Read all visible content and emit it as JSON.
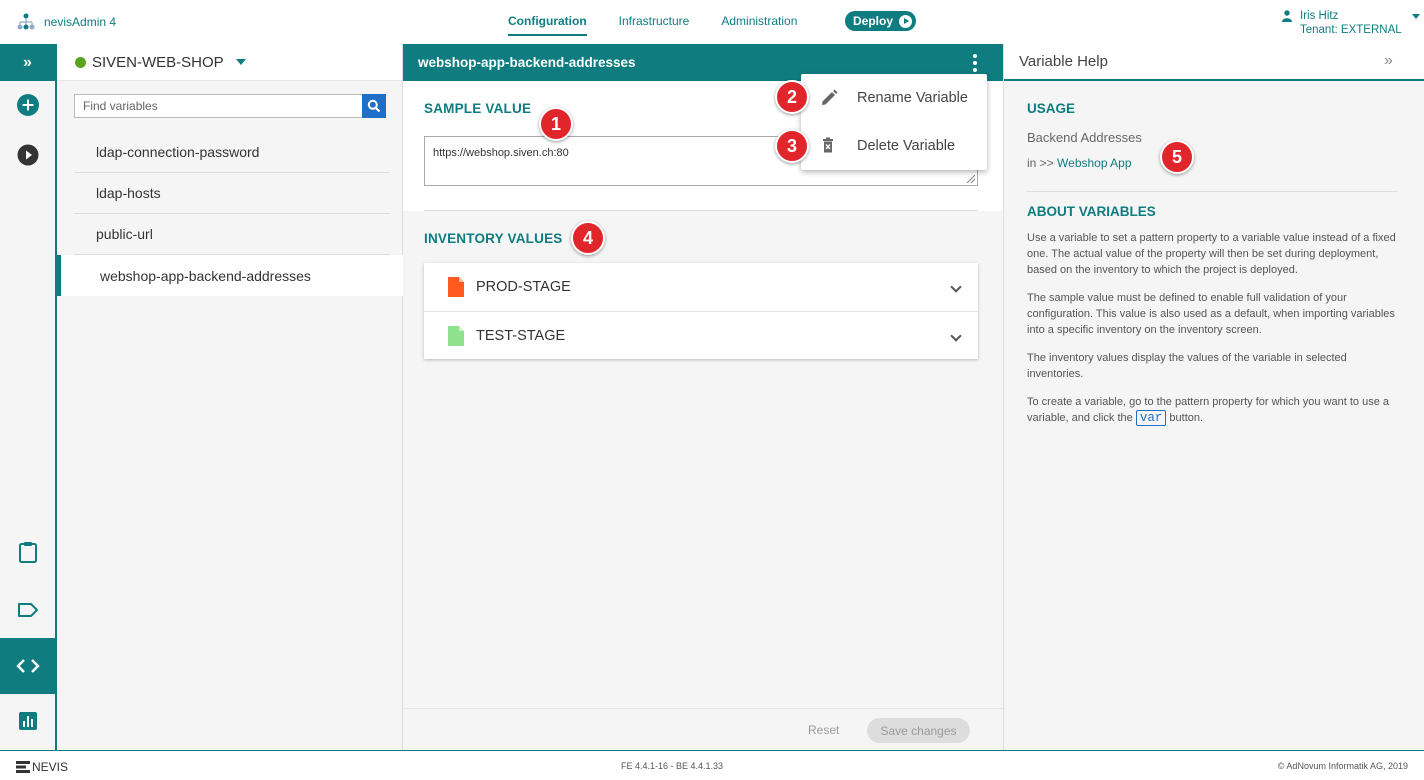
{
  "app": {
    "name": "nevisAdmin 4"
  },
  "nav": {
    "tabs": [
      {
        "label": "Configuration",
        "active": true
      },
      {
        "label": "Infrastructure",
        "active": false
      },
      {
        "label": "Administration",
        "active": false
      }
    ],
    "deploy_label": "Deploy"
  },
  "user": {
    "name": "Iris Hitz",
    "tenant": "Tenant: EXTERNAL"
  },
  "project": {
    "name": "SIVEN-WEB-SHOP",
    "status_color": "#5aa31e"
  },
  "search": {
    "placeholder": "Find variables"
  },
  "variables": [
    {
      "name": "ldap-connection-password"
    },
    {
      "name": "ldap-hosts"
    },
    {
      "name": "public-url"
    },
    {
      "name": "webshop-app-backend-addresses",
      "selected": true
    }
  ],
  "editor": {
    "title": "webshop-app-backend-addresses",
    "sample_value_title": "SAMPLE VALUE",
    "sample_value": "https://webshop.siven.ch:80",
    "inventory_title": "INVENTORY VALUES",
    "inventories": [
      {
        "name": "PROD-STAGE",
        "icon": "file-red-icon",
        "color": "#ff5a1f"
      },
      {
        "name": "TEST-STAGE",
        "icon": "file-green-icon",
        "color": "#8fe08f"
      }
    ],
    "reset_label": "Reset",
    "save_label": "Save changes"
  },
  "menu": {
    "items": [
      {
        "label": "Rename Variable",
        "icon": "pencil-icon"
      },
      {
        "label": "Delete Variable",
        "icon": "trash-icon"
      }
    ]
  },
  "help": {
    "title": "Variable Help",
    "usage_title": "USAGE",
    "usage_name": "Backend Addresses",
    "usage_in_prefix": "in >> ",
    "usage_link": "Webshop App",
    "about_title": "ABOUT VARIABLES",
    "paragraphs": [
      "Use a variable to set a pattern property to a variable value instead of a fixed one. The actual value of the property will then be set during deployment, based on the inventory to which the project is deployed.",
      "The sample value must be defined to enable full validation of your configuration. This value is also used as a default, when importing variables into a specific inventory on the inventory screen.",
      "The inventory values display the values of the variable in selected inventories."
    ],
    "last_para_before": "To create a variable, go to the pattern property for which you want to use a variable, and click the ",
    "var_button": "var",
    "last_para_after": " button."
  },
  "badges": [
    "1",
    "2",
    "3",
    "4",
    "5"
  ],
  "footer": {
    "logo": "NEVIS",
    "version": "FE 4.4.1-16 - BE 4.4.1.33",
    "copyright": "© AdNovum Informatik AG, 2019"
  },
  "colors": {
    "accent": "#0f7c80",
    "badge": "#e0262b",
    "link_blue": "#1e6fc7"
  }
}
